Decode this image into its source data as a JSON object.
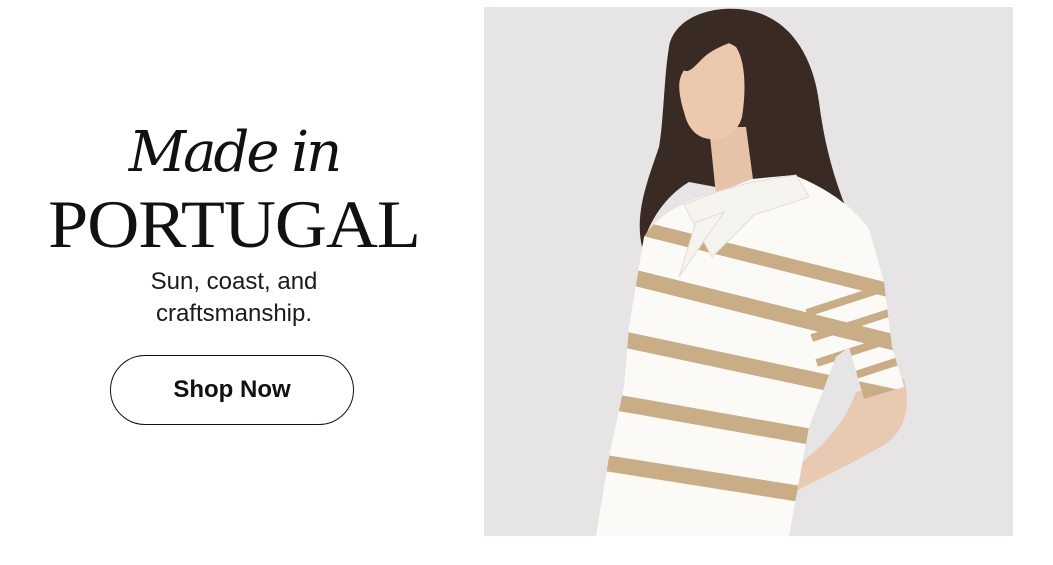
{
  "headline": {
    "line1": "Made in",
    "line2": "PORTUGAL"
  },
  "subtitle": {
    "line1": "Sun, coast, and",
    "line2": "craftsmanship."
  },
  "cta": {
    "label": "Shop Now"
  },
  "colors": {
    "text": "#111111",
    "background": "#ffffff",
    "photo_background": "#e7e4e6",
    "stripe": "#c9ad86",
    "sweater": "#fbfaf7"
  }
}
